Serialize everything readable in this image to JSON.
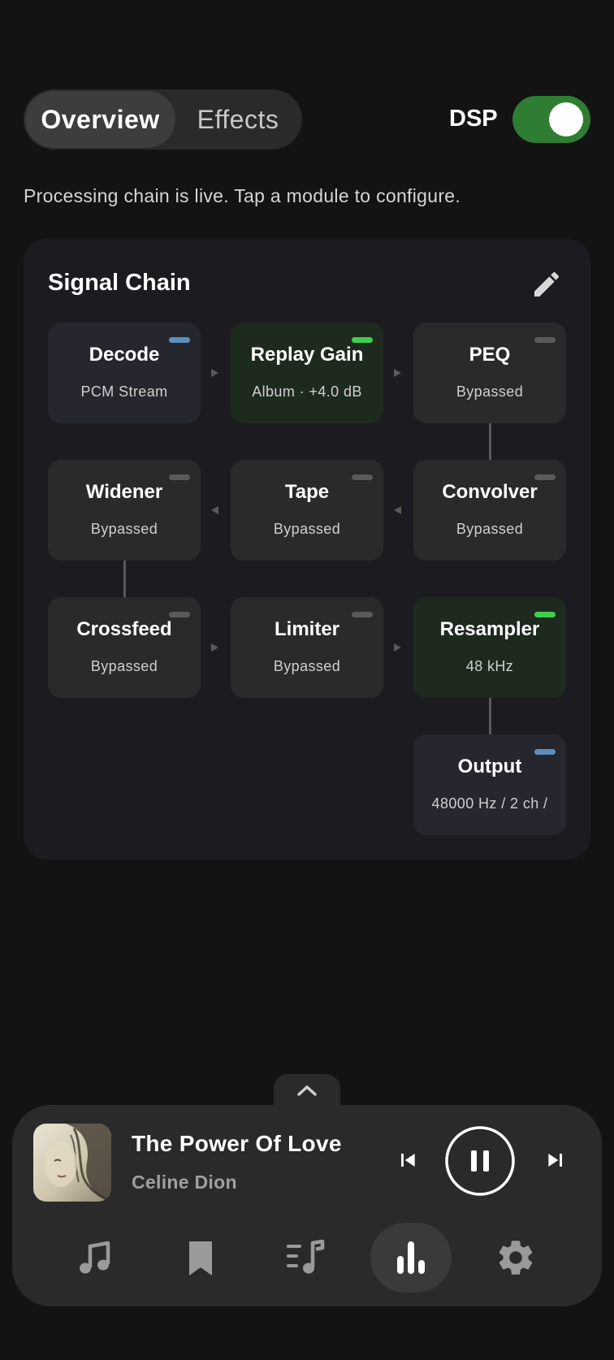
{
  "tabs": [
    {
      "label": "Overview",
      "active": true
    },
    {
      "label": "Effects",
      "active": false
    }
  ],
  "dsp": {
    "label": "DSP",
    "enabled": true,
    "color": "#2e7d32"
  },
  "status_text": "Processing chain is live. Tap a module to configure.",
  "signal_chain": {
    "title": "Signal Chain",
    "edit_icon": "pencil-icon",
    "modules": [
      {
        "name": "Decode",
        "sub": "PCM Stream",
        "state": "info"
      },
      {
        "name": "Replay Gain",
        "sub": "Album · +4.0 dB",
        "state": "active"
      },
      {
        "name": "PEQ",
        "sub": "Bypassed",
        "state": "bypassed"
      },
      {
        "name": "Widener",
        "sub": "Bypassed",
        "state": "bypassed"
      },
      {
        "name": "Tape",
        "sub": "Bypassed",
        "state": "bypassed"
      },
      {
        "name": "Convolver",
        "sub": "Bypassed",
        "state": "bypassed"
      },
      {
        "name": "Crossfeed",
        "sub": "Bypassed",
        "state": "bypassed"
      },
      {
        "name": "Limiter",
        "sub": "Bypassed",
        "state": "bypassed"
      },
      {
        "name": "Resampler",
        "sub": "48 kHz",
        "state": "active"
      },
      {
        "name": "Output",
        "sub": "48000 Hz / 2 ch /",
        "state": "info"
      }
    ],
    "colors": {
      "info": "#5b8fbf",
      "active": "#3fcf4a",
      "bypassed": "#5a5a5a"
    }
  },
  "now_playing": {
    "title": "The Power Of Love",
    "artist": "Celine Dion",
    "album_art_icon": "album-art",
    "controls": [
      "skip-previous-icon",
      "pause-icon",
      "skip-next-icon"
    ]
  },
  "bottom_nav": [
    {
      "icon": "music-note-icon",
      "active": false
    },
    {
      "icon": "bookmark-icon",
      "active": false
    },
    {
      "icon": "queue-music-icon",
      "active": false
    },
    {
      "icon": "equalizer-icon",
      "active": true
    },
    {
      "icon": "settings-icon",
      "active": false
    }
  ]
}
